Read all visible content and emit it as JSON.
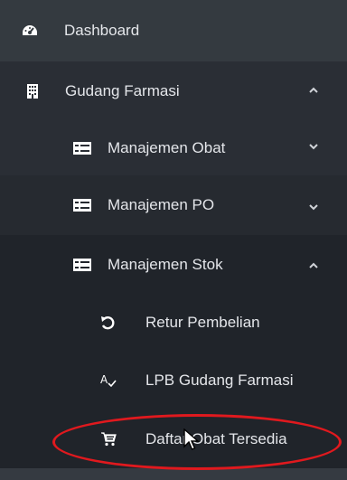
{
  "sidebar": {
    "dashboard": {
      "label": "Dashboard",
      "icon": "tachometer-icon"
    },
    "gudang": {
      "label": "Gudang Farmasi",
      "icon": "building-icon",
      "chevron": "^"
    },
    "obat": {
      "label": "Manajemen Obat",
      "icon": "list-icon",
      "chevron": "v"
    },
    "po": {
      "label": "Manajemen PO",
      "icon": "list-icon",
      "chevron": "v"
    },
    "stok": {
      "label": "Manajemen Stok",
      "icon": "list-icon",
      "chevron": "^"
    },
    "retur": {
      "label": "Retur Pembelian",
      "icon": "undo-icon"
    },
    "lpb": {
      "label": "LPB Gudang Farmasi",
      "icon": "spell-check-icon"
    },
    "daftar": {
      "label": "Daftar Obat Tersedia",
      "icon": "cart-icon"
    }
  },
  "colors": {
    "highlight_ellipse": "#e0191e",
    "sidebar_bg": "#2a2e35",
    "active_bg": "#343a40"
  }
}
